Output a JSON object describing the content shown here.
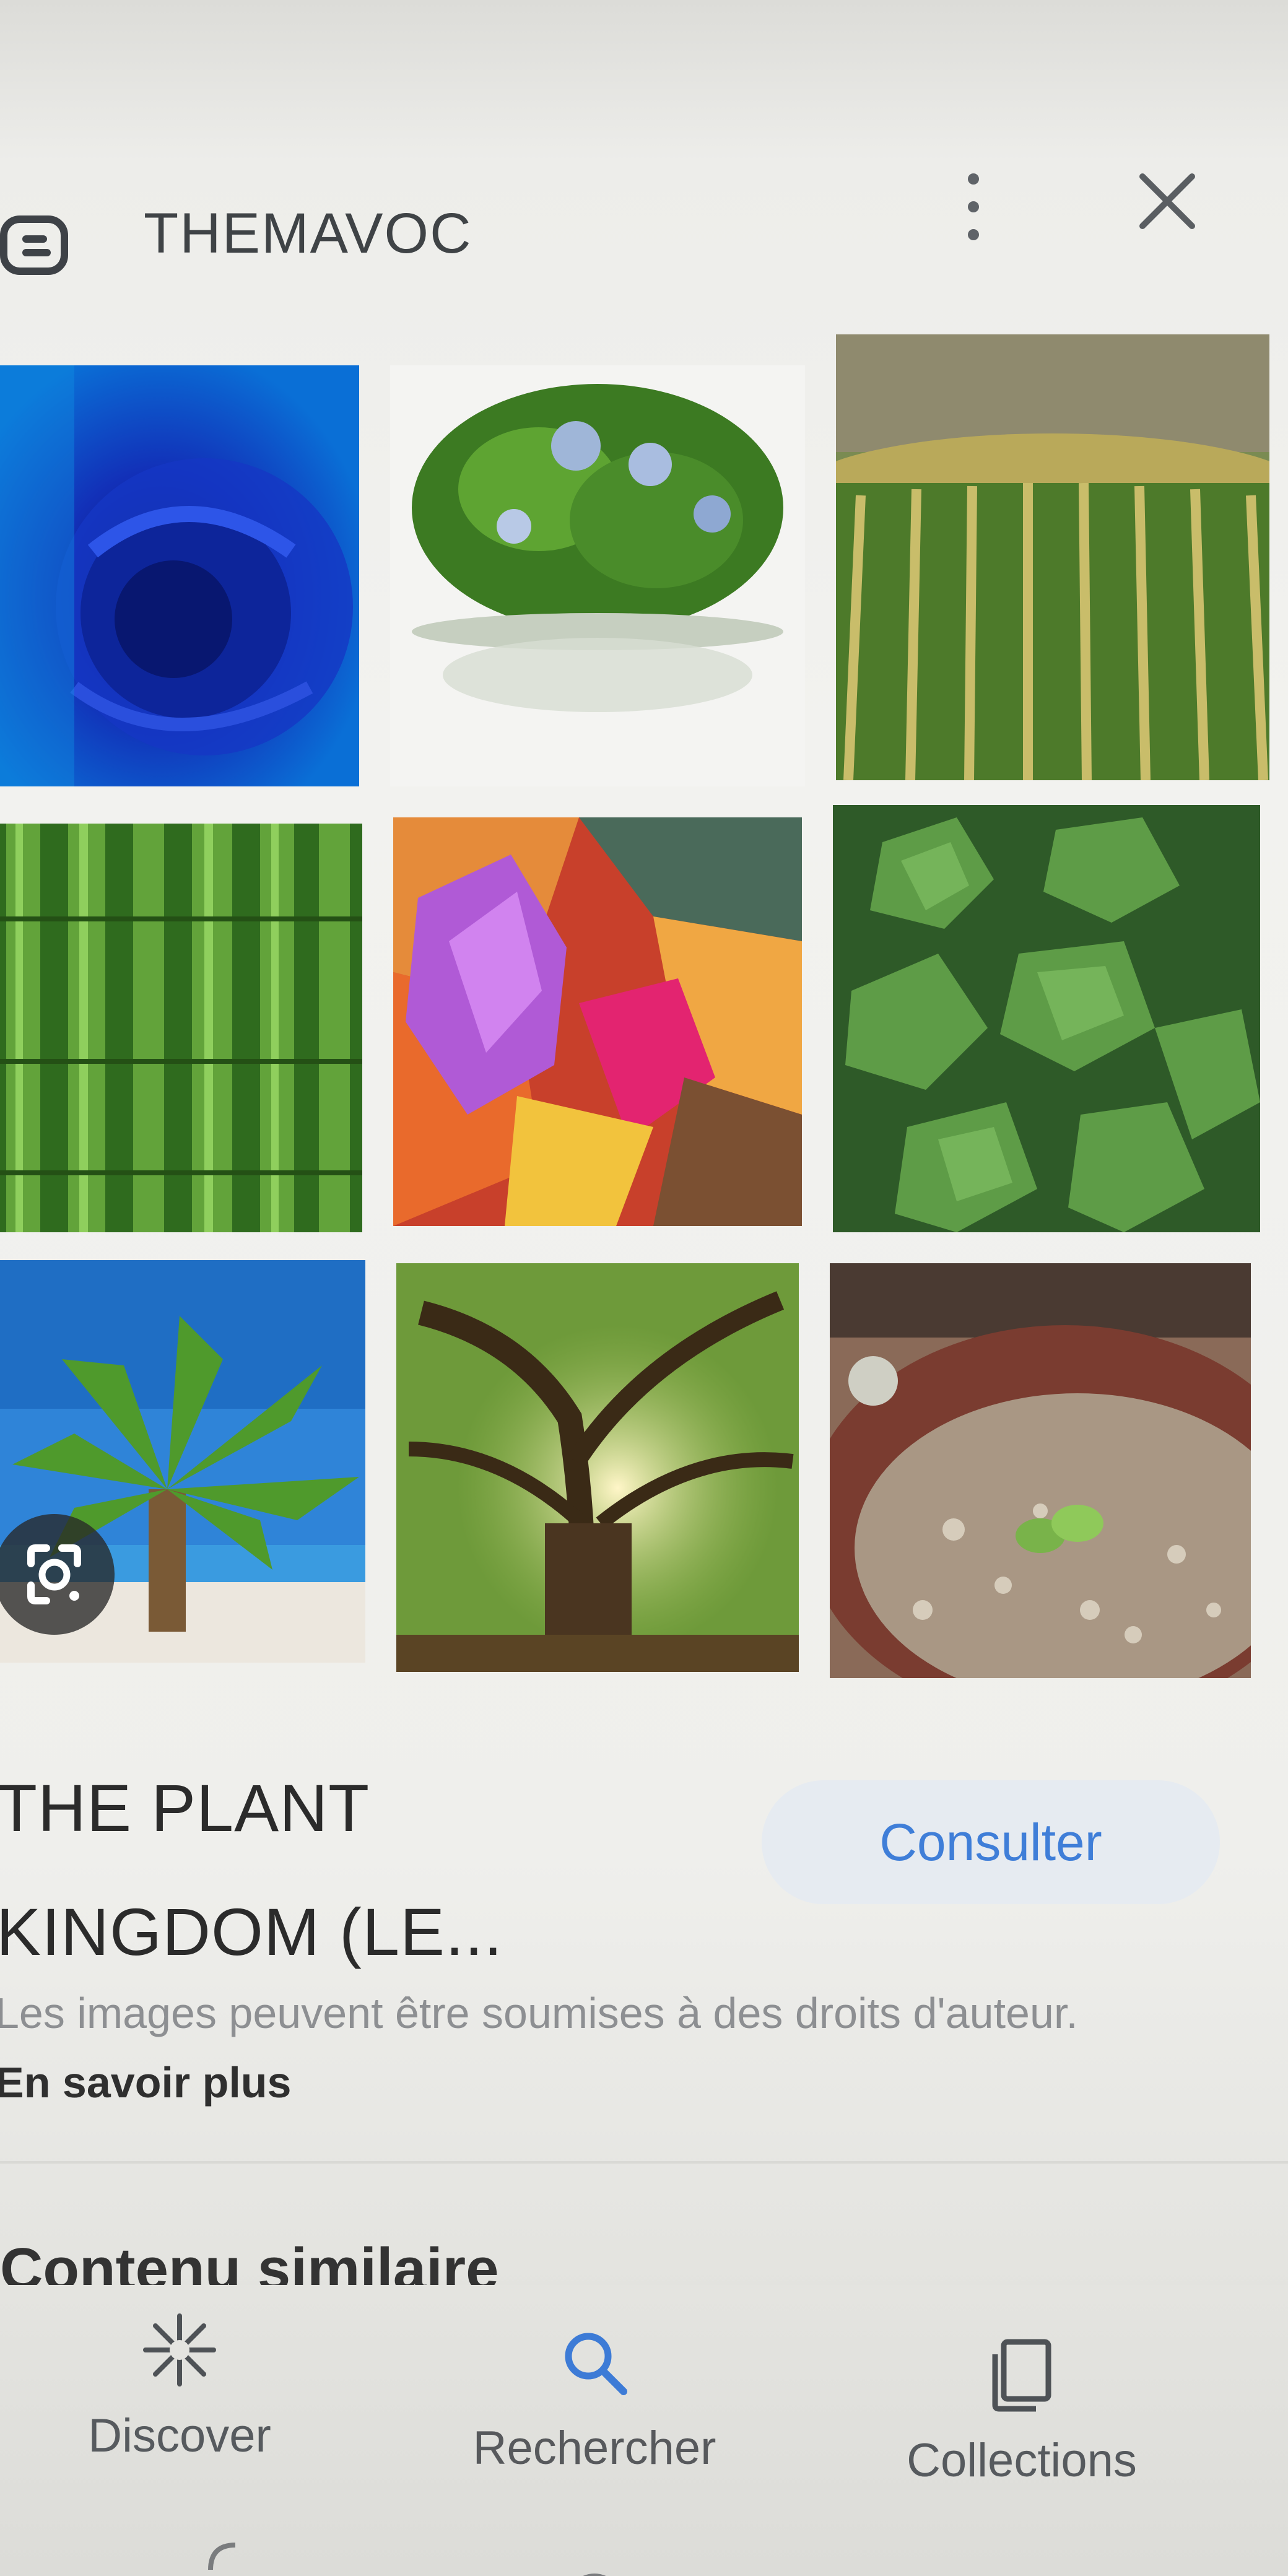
{
  "header": {
    "site_name": "THEMAVOC",
    "logo_icon": "blogger-logo-icon",
    "more_icon": "more-vert-icon",
    "close_icon": "close-icon"
  },
  "grid": {
    "tiles": [
      {
        "id": "blue-rose"
      },
      {
        "id": "flower-bush"
      },
      {
        "id": "cactus"
      },
      {
        "id": "bamboo"
      },
      {
        "id": "autumn-leaves"
      },
      {
        "id": "ivy"
      },
      {
        "id": "palm-tree"
      },
      {
        "id": "tree"
      },
      {
        "id": "seedling-pot"
      }
    ],
    "lens_icon": "google-lens-icon"
  },
  "result": {
    "title_line1": "THE PLANT",
    "title_line2": "KINGDOM (LE...",
    "visit_label": "Consulter",
    "copyright_text": "Les images peuvent être soumises à des droits d'auteur.",
    "learn_more": "En savoir plus",
    "similar_heading": "Contenu similaire"
  },
  "bottom_nav": {
    "items": [
      {
        "label": "Discover",
        "icon": "discover-asterisk-icon"
      },
      {
        "label": "Rechercher",
        "icon": "search-icon"
      },
      {
        "label": "Collections",
        "icon": "collections-icon"
      }
    ]
  },
  "colors": {
    "accent": "#3f7ed8",
    "visit_bg": "#e6ebf1",
    "text_dark": "#2b2b2b",
    "text_muted": "#8d8f92"
  }
}
